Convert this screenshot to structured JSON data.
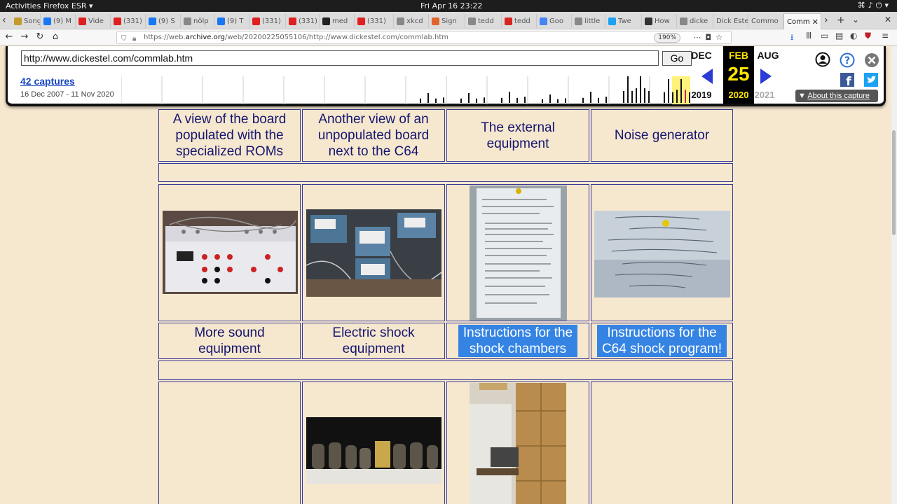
{
  "system": {
    "activities": "Activities",
    "app_menu": "Firefox ESR ▾",
    "clock": "Fri Apr 16  23:22"
  },
  "tabs": [
    {
      "label": "Song",
      "color": "#c49a2a"
    },
    {
      "label": "(9) M",
      "color": "#1877f2"
    },
    {
      "label": "Vide",
      "color": "#e02020"
    },
    {
      "label": "(331)",
      "color": "#e02020"
    },
    {
      "label": "(9) S",
      "color": "#1877f2"
    },
    {
      "label": "nölp",
      "color": "#888888"
    },
    {
      "label": "(9) T",
      "color": "#1877f2"
    },
    {
      "label": "(331)",
      "color": "#e02020"
    },
    {
      "label": "(331)",
      "color": "#e02020"
    },
    {
      "label": "med",
      "color": "#222222"
    },
    {
      "label": "(331)",
      "color": "#e02020"
    },
    {
      "label": "xkcd",
      "color": "#888888"
    },
    {
      "label": "Sign",
      "color": "#e2632a"
    },
    {
      "label": "tedd",
      "color": "#888888"
    },
    {
      "label": "tedd",
      "color": "#d6251f"
    },
    {
      "label": "Goo",
      "color": "#4285f4"
    },
    {
      "label": "little",
      "color": "#888888"
    },
    {
      "label": "Twe",
      "color": "#1da1f2"
    },
    {
      "label": "How",
      "color": "#333333"
    },
    {
      "label": "dicke",
      "color": "#888888"
    },
    {
      "label": "Dick Este",
      "color": ""
    },
    {
      "label": "Commo",
      "color": ""
    },
    {
      "label": "Comm",
      "color": "",
      "active": true
    }
  ],
  "address_bar": {
    "url_prefix": "https://web.",
    "url_host": "archive.org",
    "url_rest": "/web/20200225055106/http://www.dickestel.com/commlab.htm",
    "zoom": "190%"
  },
  "wayback": {
    "url_value": "http://www.dickestel.com/commlab.htm",
    "go_label": "Go",
    "captures_label": "42 captures",
    "date_range": "16 Dec 2007 - 11 Nov 2020",
    "prev_month": "DEC",
    "current_month": "FEB",
    "next_month": "AUG",
    "current_day": "25",
    "prev_year": "2019",
    "current_year": "2020",
    "next_year": "2021",
    "about_label": "About this capture",
    "sparkline_year_heights": [
      0,
      0,
      0,
      0,
      0,
      0,
      0,
      0.35,
      0.35,
      0.4,
      0.3,
      0.4,
      0.95,
      0.85
    ],
    "accent_color": "#2a3bd6",
    "highlight_color": "#fff27a"
  },
  "content": {
    "row1_captions": [
      "A view of the board populated with the specialized ROMs",
      "Another view of an unpopulated board next to the C64",
      "The external equipment",
      "Noise generator"
    ],
    "row2_images": [
      "patch-panel-photo",
      "meters-equipment-photo",
      "instructions-sheet-photo",
      "c64-program-sheet-photo"
    ],
    "row3_captions": [
      "More sound equipment",
      "Electric shock equipment",
      "Instructions for the shock chambers",
      "Instructions for the C64 shock program!"
    ],
    "row4_images": [
      "",
      "tubes-equipment-photo",
      "shock-chamber-room-photo",
      ""
    ]
  }
}
